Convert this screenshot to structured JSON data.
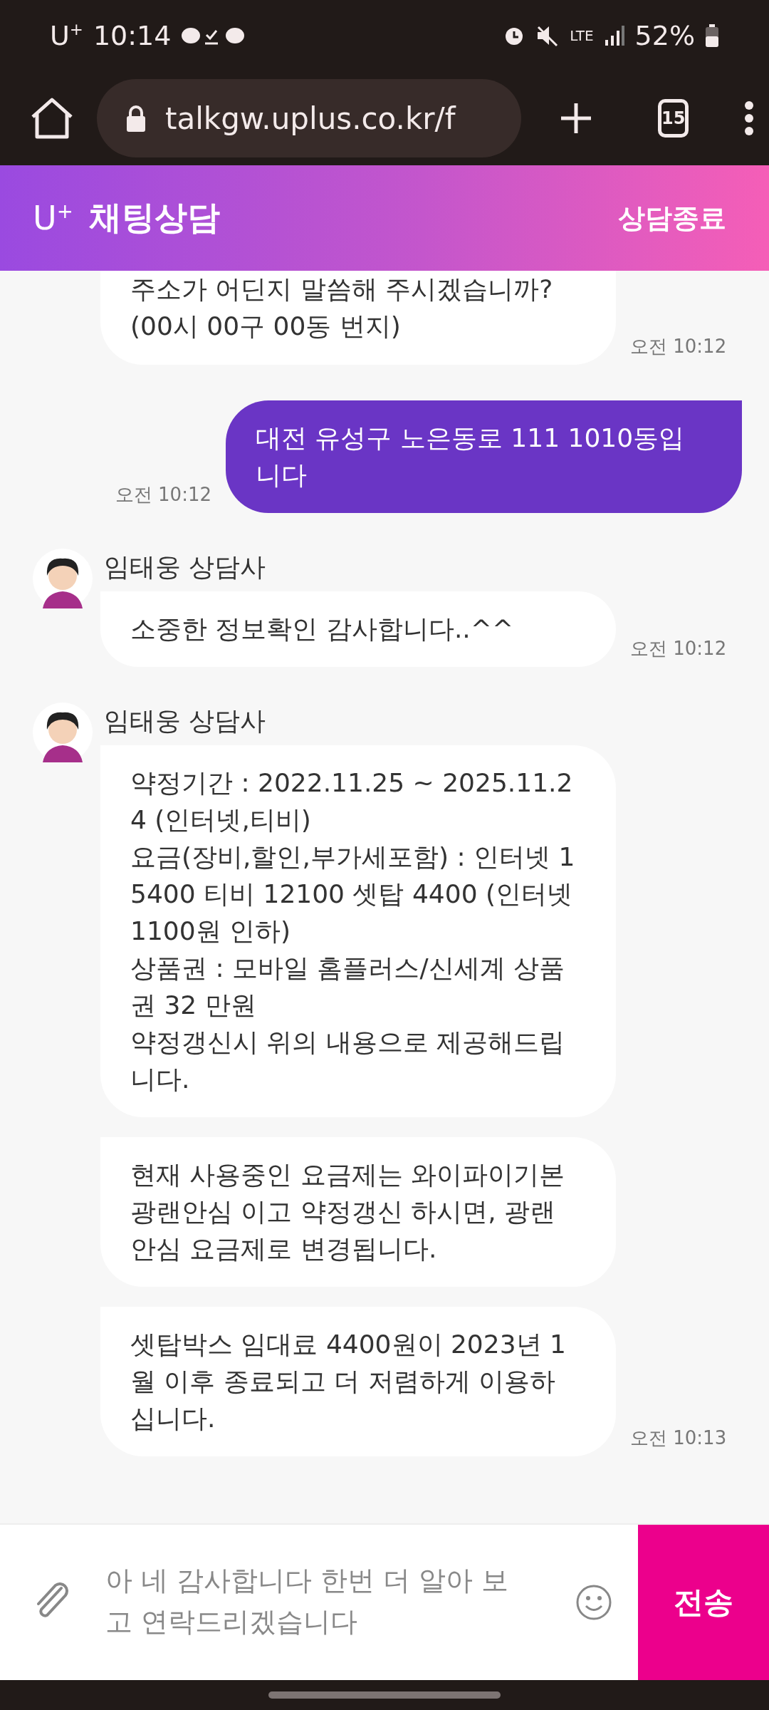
{
  "status_bar": {
    "carrier": "U$^{+}$",
    "time": "10:14",
    "network": "LTE",
    "battery": "52%"
  },
  "browser": {
    "url": "talkgw.uplus.co.kr/f",
    "tab_count": "15"
  },
  "header": {
    "logo": "U$^{+}$",
    "title": "채팅상담",
    "end_button": "상담종료"
  },
  "messages": [
    {
      "kind": "incoming",
      "lines": [
        "주소가 어딘지 말씀해 주시겠습니까?",
        "(00시 00구 00동 번지)"
      ],
      "time": "오전 10:12"
    },
    {
      "kind": "outgoing",
      "lines": [
        "대전 유성구 노은동로 111 1010동입",
        "니다"
      ],
      "time": "오전 10:12"
    },
    {
      "kind": "incoming",
      "sender": "임태웅 상담사",
      "lines": [
        "소중한 정보확인 감사합니다..^^"
      ],
      "time": "오전 10:12"
    },
    {
      "kind": "incoming",
      "sender": "임태웅 상담사",
      "lines": [
        "약정기간 : 2022.11.25 ~ 2025.11.2",
        "4 (인터넷,티비)",
        "요금(장비,할인,부가세포함) : 인터넷 1",
        "5400 티비 12100 셋탑 4400 (인터넷",
        "1100원 인하)",
        "상품권 : 모바일 홈플러스/신세계 상품",
        "권 32 만원",
        "약정갱신시 위의 내용으로 제공해드립",
        "니다."
      ]
    },
    {
      "kind": "incoming",
      "lines": [
        "현재 사용중인 요금제는 와이파이기본",
        "광랜안심 이고 약정갱신 하시면, 광랜",
        "안심 요금제로 변경됩니다."
      ]
    },
    {
      "kind": "incoming",
      "lines": [
        "셋탑박스 임대료 4400원이 2023년 1",
        "월 이후 종료되고 더 저렴하게 이용하",
        "십니다."
      ],
      "time": "오전 10:13"
    }
  ],
  "composer": {
    "placeholder": "아 네 감사합니다 한번 더 알아 보고 연락드리겠습니다",
    "send_button": "전송"
  }
}
